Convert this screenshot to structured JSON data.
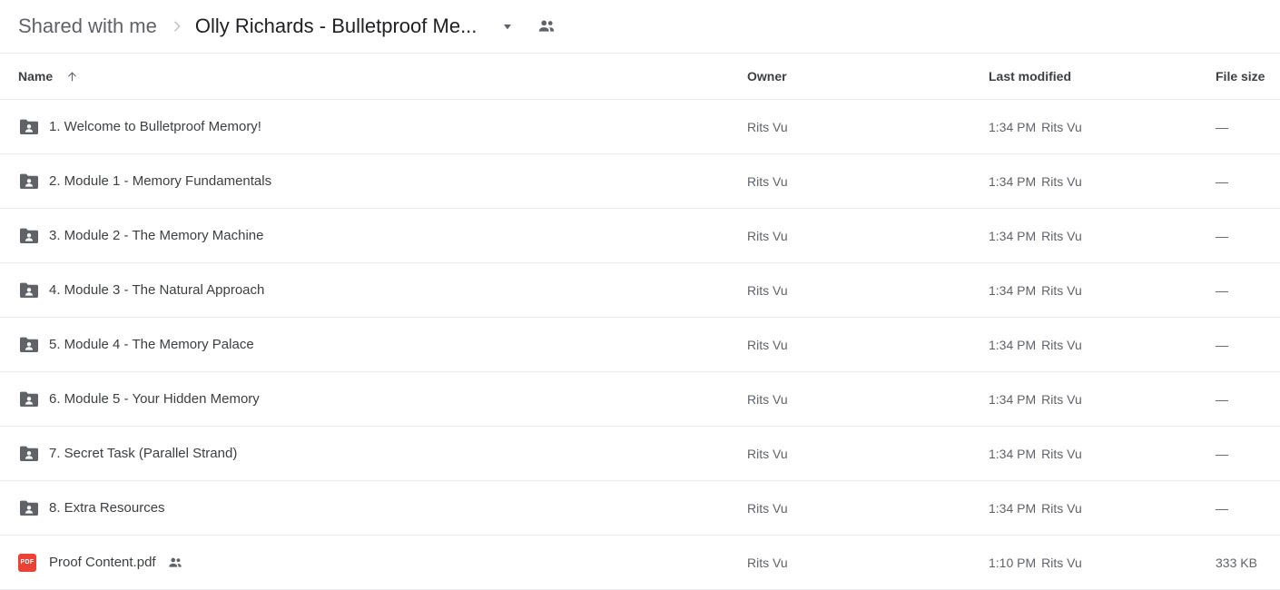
{
  "breadcrumb": {
    "root_label": "Shared with me",
    "separator_icon": "chevron-right-icon",
    "current_label": "Olly Richards - Bulletproof Me...",
    "caret_icon": "chevron-down-icon",
    "people_icon": "people-shared-icon"
  },
  "table": {
    "columns": {
      "name": "Name",
      "owner": "Owner",
      "modified": "Last modified",
      "size": "File size"
    },
    "sort_icon": "arrow-up-icon",
    "sort_column": "Name",
    "rows": [
      {
        "icon": "shared-folder-icon",
        "name": "1. Welcome to Bulletproof Memory!",
        "shared": false,
        "owner": "Rits Vu",
        "modified_time": "1:34 PM",
        "modified_by": "Rits Vu",
        "size": "—"
      },
      {
        "icon": "shared-folder-icon",
        "name": "2. Module 1 - Memory Fundamentals",
        "shared": false,
        "owner": "Rits Vu",
        "modified_time": "1:34 PM",
        "modified_by": "Rits Vu",
        "size": "—"
      },
      {
        "icon": "shared-folder-icon",
        "name": "3. Module 2 - The Memory Machine",
        "shared": false,
        "owner": "Rits Vu",
        "modified_time": "1:34 PM",
        "modified_by": "Rits Vu",
        "size": "—"
      },
      {
        "icon": "shared-folder-icon",
        "name": "4. Module 3 - The Natural Approach",
        "shared": false,
        "owner": "Rits Vu",
        "modified_time": "1:34 PM",
        "modified_by": "Rits Vu",
        "size": "—"
      },
      {
        "icon": "shared-folder-icon",
        "name": "5. Module 4 - The Memory Palace",
        "shared": false,
        "owner": "Rits Vu",
        "modified_time": "1:34 PM",
        "modified_by": "Rits Vu",
        "size": "—"
      },
      {
        "icon": "shared-folder-icon",
        "name": "6. Module 5 - Your Hidden Memory",
        "shared": false,
        "owner": "Rits Vu",
        "modified_time": "1:34 PM",
        "modified_by": "Rits Vu",
        "size": "—"
      },
      {
        "icon": "shared-folder-icon",
        "name": "7. Secret Task (Parallel Strand)",
        "shared": false,
        "owner": "Rits Vu",
        "modified_time": "1:34 PM",
        "modified_by": "Rits Vu",
        "size": "—"
      },
      {
        "icon": "shared-folder-icon",
        "name": "8. Extra Resources",
        "shared": false,
        "owner": "Rits Vu",
        "modified_time": "1:34 PM",
        "modified_by": "Rits Vu",
        "size": "—"
      },
      {
        "icon": "pdf-file-icon",
        "icon_label": "PDF",
        "name": "Proof Content.pdf",
        "shared": true,
        "owner": "Rits Vu",
        "modified_time": "1:10 PM",
        "modified_by": "Rits Vu",
        "size": "333 KB"
      }
    ]
  },
  "colors": {
    "folder_icon": "#5f6368",
    "pdf_icon": "#ea4335",
    "primary_text": "#3c4043",
    "secondary_text": "#5f6368",
    "divider": "#e8eaed"
  }
}
